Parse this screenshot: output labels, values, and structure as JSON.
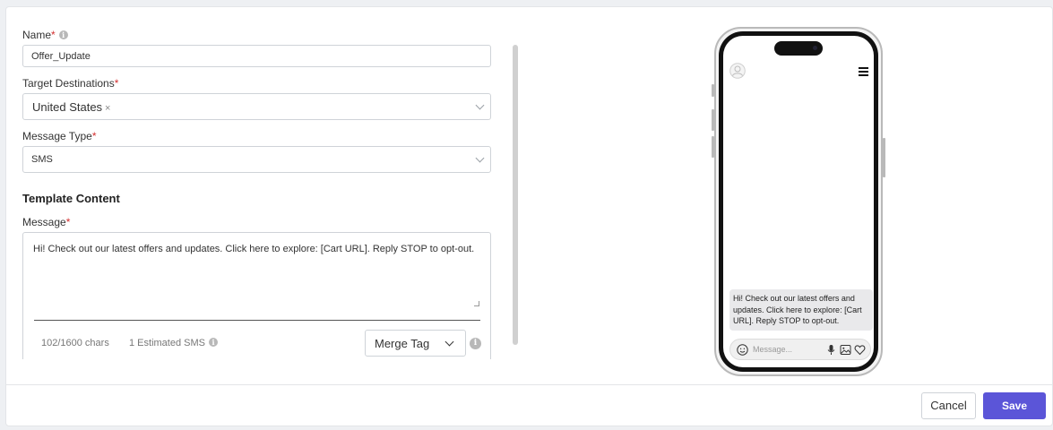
{
  "form": {
    "name_label": "Name",
    "name_value": "Offer_Update",
    "required_mark": "*",
    "info_glyph": "i",
    "destinations_label": "Target Destinations",
    "destinations": [
      {
        "label": "United States",
        "remove": "×"
      }
    ],
    "message_type_label": "Message Type",
    "message_type_value": "SMS",
    "section_title": "Template Content",
    "message_label": "Message",
    "message_value": "Hi! Check out our latest offers and updates. Click here to explore: [Cart URL]. Reply STOP to opt-out.",
    "char_count": "102/1600 chars",
    "estimated_sms": "1 Estimated SMS",
    "merge_tag_label": "Merge Tag"
  },
  "preview": {
    "bubble_text": "Hi! Check out our latest offers and updates. Click here to explore: [Cart URL]. Reply STOP to opt-out.",
    "composer_placeholder": "Message..."
  },
  "footer": {
    "cancel_label": "Cancel",
    "save_label": "Save"
  },
  "colors": {
    "accent": "#5b55d8",
    "required": "#d32f2f"
  },
  "icons": [
    "info-icon",
    "close-icon",
    "chevron-down-icon",
    "avatar-icon",
    "hamburger-menu-icon",
    "emoji-icon",
    "microphone-icon",
    "image-icon",
    "heart-icon"
  ]
}
